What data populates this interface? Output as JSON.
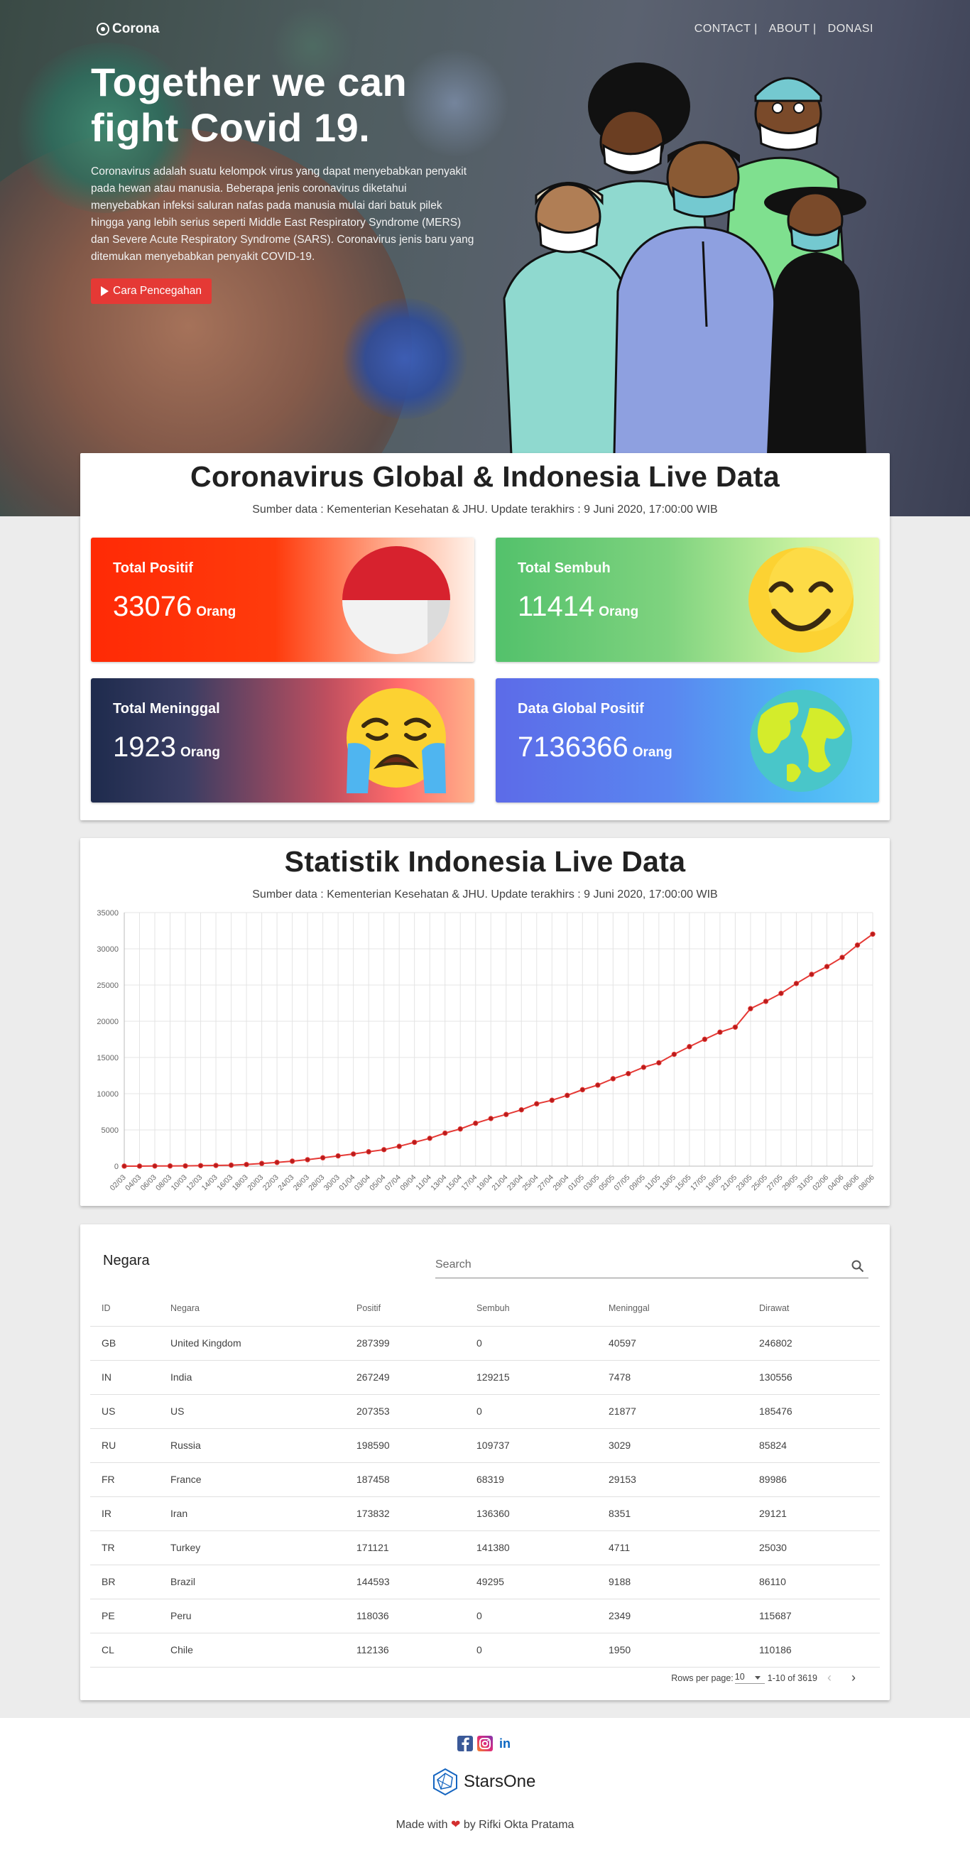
{
  "nav": {
    "brand": "Corona",
    "links": [
      "CONTACT |",
      "ABOUT |",
      "DONASI"
    ]
  },
  "hero": {
    "title_line1": "Together we can",
    "title_line2": "fight Covid 19.",
    "description": "Coronavirus adalah suatu kelompok virus yang dapat menyebabkan penyakit pada hewan atau manusia. Beberapa jenis coronavirus diketahui menyebabkan infeksi saluran nafas pada manusia mulai dari batuk pilek hingga yang lebih serius seperti Middle East Respiratory Syndrome (MERS) dan Severe Acute Respiratory Syndrome (SARS). Coronavirus jenis baru yang ditemukan menyebabkan penyakit COVID-19.",
    "button_label": "Cara Pencegahan"
  },
  "live": {
    "title": "Coronavirus Global & Indonesia Live Data",
    "subtitle": "Sumber data : Kementerian Kesehatan & JHU. Update terakhirs : 9 Juni 2020, 17:00:00 WIB",
    "stats": [
      {
        "label": "Total Positif",
        "value": "33076",
        "unit": "Orang",
        "icon": "indonesia-flag-icon"
      },
      {
        "label": "Total Sembuh",
        "value": "11414",
        "unit": "Orang",
        "icon": "smiling-face-icon"
      },
      {
        "label": "Total Meninggal",
        "value": "1923",
        "unit": "Orang",
        "icon": "crying-face-icon"
      },
      {
        "label": "Data Global Positif",
        "value": "7136366",
        "unit": "Orang",
        "icon": "earth-globe-icon"
      }
    ]
  },
  "chart_section": {
    "title": "Statistik Indonesia Live Data",
    "subtitle": "Sumber data : Kementerian Kesehatan & JHU. Update terakhirs : 9 Juni 2020, 17:00:00 WIB"
  },
  "chart_data": {
    "type": "line",
    "ylim": [
      0,
      35000
    ],
    "yticks": [
      0,
      5000,
      10000,
      15000,
      20000,
      25000,
      30000,
      35000
    ],
    "grid": true,
    "line_color": "#e53935",
    "point_color": "#b71c1c",
    "x_labels": [
      "02/03",
      "04/03",
      "06/03",
      "08/03",
      "10/03",
      "12/03",
      "14/03",
      "16/03",
      "18/03",
      "20/03",
      "22/03",
      "24/03",
      "26/03",
      "28/03",
      "30/03",
      "01/04",
      "03/04",
      "05/04",
      "07/04",
      "09/04",
      "11/04",
      "13/04",
      "15/04",
      "17/04",
      "19/04",
      "21/04",
      "23/04",
      "25/04",
      "27/04",
      "29/04",
      "01/05",
      "03/05",
      "05/05",
      "07/05",
      "09/05",
      "11/05",
      "13/05",
      "15/05",
      "17/05",
      "19/05",
      "21/05",
      "23/05",
      "25/05",
      "27/05",
      "29/05",
      "31/05",
      "02/06",
      "04/06",
      "06/06",
      "08/06"
    ],
    "values": [
      2,
      2,
      19,
      27,
      34,
      69,
      96,
      134,
      227,
      369,
      514,
      686,
      893,
      1155,
      1414,
      1677,
      1986,
      2273,
      2738,
      3293,
      3842,
      4557,
      5136,
      5923,
      6575,
      7135,
      7775,
      8607,
      9096,
      9771,
      10551,
      11192,
      12071,
      12776,
      13645,
      14265,
      15438,
      16496,
      17514,
      18496,
      19189,
      21745,
      22750,
      23851,
      25216,
      26473,
      27549,
      28818,
      30514,
      32033
    ]
  },
  "table": {
    "heading": "Negara",
    "search_placeholder": "Search",
    "columns": [
      "ID",
      "Negara",
      "Positif",
      "Sembuh",
      "Meninggal",
      "Dirawat"
    ],
    "rows": [
      [
        "GB",
        "United Kingdom",
        "287399",
        "0",
        "40597",
        "246802"
      ],
      [
        "IN",
        "India",
        "267249",
        "129215",
        "7478",
        "130556"
      ],
      [
        "US",
        "US",
        "207353",
        "0",
        "21877",
        "185476"
      ],
      [
        "RU",
        "Russia",
        "198590",
        "109737",
        "3029",
        "85824"
      ],
      [
        "FR",
        "France",
        "187458",
        "68319",
        "29153",
        "89986"
      ],
      [
        "IR",
        "Iran",
        "173832",
        "136360",
        "8351",
        "29121"
      ],
      [
        "TR",
        "Turkey",
        "171121",
        "141380",
        "4711",
        "25030"
      ],
      [
        "BR",
        "Brazil",
        "144593",
        "49295",
        "9188",
        "86110"
      ],
      [
        "PE",
        "Peru",
        "118036",
        "0",
        "2349",
        "115687"
      ],
      [
        "CL",
        "Chile",
        "112136",
        "0",
        "1950",
        "110186"
      ]
    ],
    "rows_per_page_label": "Rows per page:",
    "rows_per_page": "10",
    "range": "1-10 of 3619"
  },
  "footer": {
    "brand": "StarsOne",
    "made_prefix": "Made with",
    "made_suffix": "by Rifki Okta Pratama",
    "socials": [
      "facebook-icon",
      "instagram-icon",
      "linkedin-icon"
    ]
  }
}
